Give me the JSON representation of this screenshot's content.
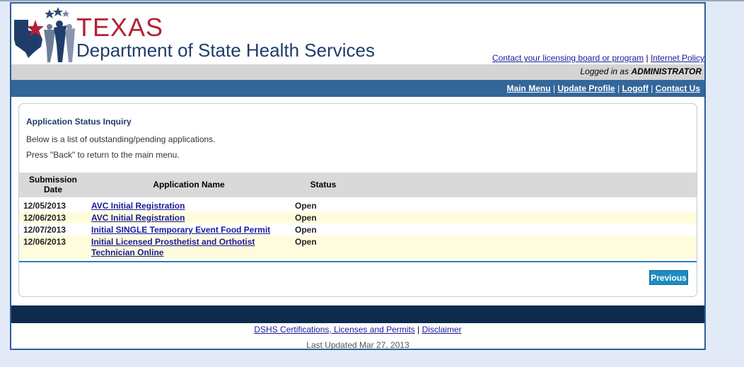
{
  "header": {
    "brand_texas": "TEXAS",
    "brand_dept": "Department of State Health Services",
    "links": [
      "Contact your licensing board or program",
      "Internet Policy"
    ],
    "link_separator": "|"
  },
  "login": {
    "prefix": "Logged in as",
    "user": "ADMINISTRATOR"
  },
  "nav": {
    "items": [
      "Main Menu",
      "Update Profile",
      "Logoff",
      "Contact Us"
    ],
    "separator": "|"
  },
  "page": {
    "title": "Application Status Inquiry",
    "line1": "Below is a list of outstanding/pending applications.",
    "line2": "Press \"Back\" to return to the main menu."
  },
  "table": {
    "headers": {
      "date_line1": "Submission",
      "date_line2": "Date",
      "name": "Application Name",
      "status": "Status"
    },
    "rows": [
      {
        "date": "12/05/2013",
        "name": "AVC Initial Registration",
        "status": "Open"
      },
      {
        "date": "12/06/2013",
        "name": "AVC Initial Registration",
        "status": "Open"
      },
      {
        "date": "12/07/2013",
        "name": "Initial SINGLE Temporary Event Food Permit",
        "status": "Open"
      },
      {
        "date": "12/06/2013",
        "name": "Initial Licensed Prosthetist and Orthotist Technician Online",
        "status": "Open"
      }
    ]
  },
  "buttons": {
    "previous": "Previous"
  },
  "footer": {
    "link1": "DSHS Certifications, Licenses and Permits",
    "separator": "|",
    "link2": "Disclaimer",
    "last_updated": "Last Updated Mar 27, 2013"
  },
  "colors": {
    "brand_red": "#b22234",
    "brand_navy": "#1f3d6b",
    "nav_blue": "#336699",
    "footer_navy": "#0e2a4f",
    "button_blue": "#1e8bc3",
    "row_highlight": "#fefcdc"
  },
  "icons": {
    "logo": "texas-dshs-logo-icon"
  }
}
